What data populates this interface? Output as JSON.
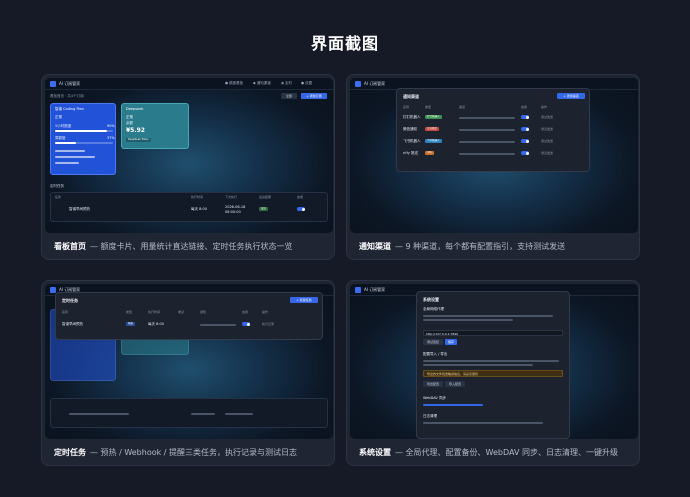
{
  "page": {
    "title": "界面截图"
  },
  "cards": [
    {
      "title": "看板首页",
      "desc": "— 额度卡片、用量统计直达链接、定时任务执行状态一览"
    },
    {
      "title": "通知渠道",
      "desc": "— 9 种渠道，每个都有配置指引，支持测试发送"
    },
    {
      "title": "定时任务",
      "desc": "— 预热 / Webhook / 提醒三类任务，执行记录与测试日志"
    },
    {
      "title": "系统设置",
      "desc": "— 全局代理、配置备份、WebDAV 同步、日志清理、一键升级"
    }
  ],
  "app": {
    "name": "AI 订阅管家",
    "nav": [
      "● 额度看板",
      "◆ 通知渠道",
      "◉ 定时",
      "● 设置"
    ]
  },
  "shot1": {
    "subtitle": "看板首页 · 共4个订阅",
    "chip_all": "全部",
    "btn_add": "+ 添加订阅",
    "blue_card": {
      "name": "智谱 Coding Plan",
      "status": "正常",
      "pct1": "90%",
      "pct2": "37%",
      "meta": "5小时额度",
      "meta2": "周额度"
    },
    "teal_card": {
      "name": "Deepseek",
      "status": "正常",
      "amount": "¥5.92",
      "meta": "余额",
      "tag": "DeepSeek Token"
    },
    "section": "定时任务",
    "headers": [
      "任务",
      "执行时间",
      "下次执行",
      "最后结果",
      "启用"
    ],
    "row": {
      "name": "智谱早间预热",
      "time": "每天 8:00",
      "next": "2026-06-18 08:00:00",
      "result": "成功"
    }
  },
  "shot2": {
    "modal_title": "通知渠道",
    "btn_add": "+ 添加渠道",
    "headers": [
      "名称",
      "类型",
      "渠道",
      "启用",
      "操作"
    ],
    "rows": [
      {
        "name": "钉钉机器人",
        "type": "钉钉机器人",
        "color": "#3a8f4e"
      },
      {
        "name": "微信通知",
        "type": "企业微信",
        "color": "#c04a3a"
      },
      {
        "name": "飞书机器人",
        "type": "飞书机器人",
        "color": "#2c7fb8"
      },
      {
        "name": "ntfy 推送",
        "type": "ntfy",
        "color": "#c7702a"
      }
    ],
    "action": "测试发送"
  },
  "shot3": {
    "modal_title": "定时任务",
    "btn_add": "+ 新建任务",
    "headers": [
      "名称",
      "类型",
      "执行时间",
      "重试",
      "通知",
      "启用",
      "操作"
    ],
    "row": {
      "name": "智谱早间预热",
      "type": "预热",
      "time": "每天 8:00",
      "action": "执行记录"
    }
  },
  "shot4": {
    "modal_title": "系统设置",
    "sections": [
      "全局网络代理",
      "配置导入 / 导出",
      "WebDAV 同步",
      "日志清理"
    ],
    "proxy_value": "http://127.0.0.1:7890",
    "btn_test": "测试连接",
    "btn_save": "保存",
    "warn": "导出的文件包含敏感信息，请妥善保管",
    "btn_export": "导出配置",
    "btn_import": "导入配置"
  }
}
